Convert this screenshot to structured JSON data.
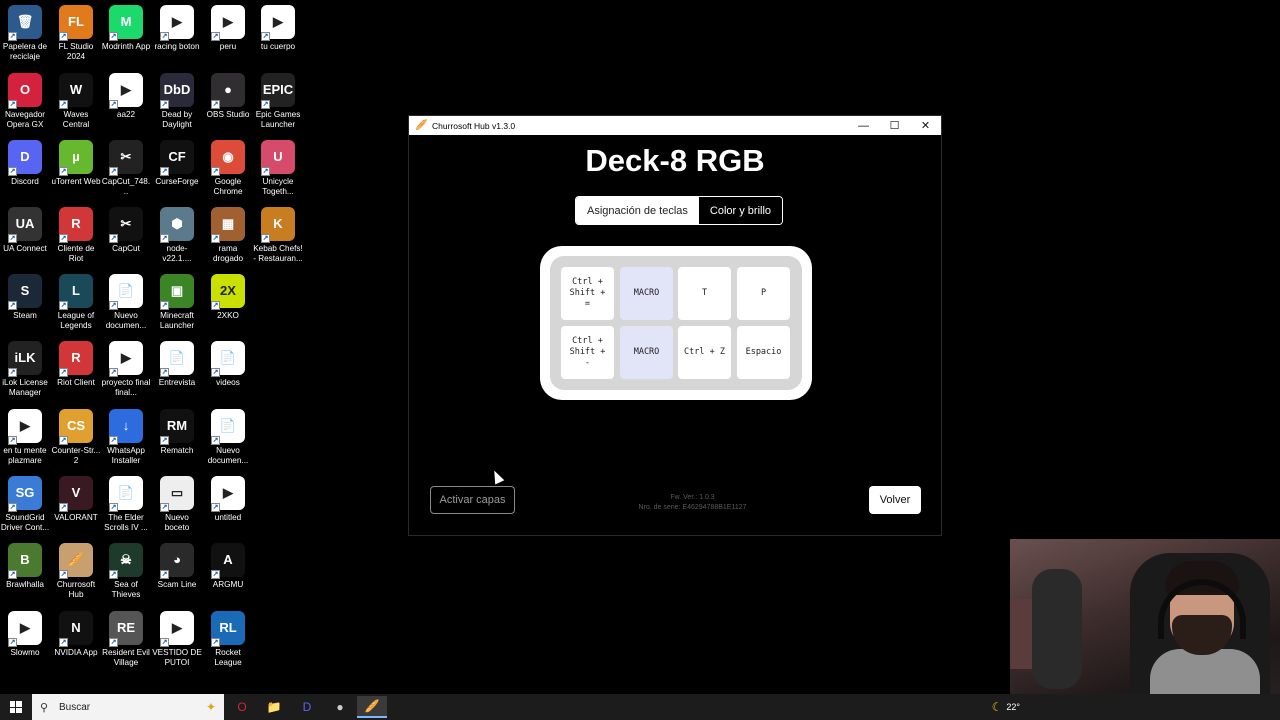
{
  "desktop": {
    "icons": [
      {
        "label": "Papelera de reciclaje",
        "glyph": "🗑",
        "color": "#2d5a8c"
      },
      {
        "label": "FL Studio 2024",
        "glyph": "FL",
        "color": "#e07a1a"
      },
      {
        "label": "Modrinth App",
        "glyph": "M",
        "color": "#1bd96a"
      },
      {
        "label": "racing boton",
        "glyph": "▶",
        "color": "#ffffff"
      },
      {
        "label": "peru",
        "glyph": "▶",
        "color": "#ffffff"
      },
      {
        "label": "tu cuerpo",
        "glyph": "▶",
        "color": "#ffffff"
      },
      {
        "label": "Navegador Opera GX",
        "glyph": "O",
        "color": "#d4213d"
      },
      {
        "label": "Waves Central",
        "glyph": "W",
        "color": "#111111"
      },
      {
        "label": "aa22",
        "glyph": "▶",
        "color": "#ffffff"
      },
      {
        "label": "Dead by Daylight",
        "glyph": "DbD",
        "color": "#2a2a3a"
      },
      {
        "label": "OBS Studio",
        "glyph": "●",
        "color": "#302e31"
      },
      {
        "label": "Epic Games Launcher",
        "glyph": "EPIC",
        "color": "#222222"
      },
      {
        "label": "Discord",
        "glyph": "D",
        "color": "#5865f2"
      },
      {
        "label": "uTorrent Web",
        "glyph": "µ",
        "color": "#66b82e"
      },
      {
        "label": "CapCut_748...",
        "glyph": "✂",
        "color": "#222222"
      },
      {
        "label": "CurseForge",
        "glyph": "CF",
        "color": "#111111"
      },
      {
        "label": "Google Chrome",
        "glyph": "◉",
        "color": "#dd4b39"
      },
      {
        "label": "Unicycle Togeth...",
        "glyph": "U",
        "color": "#d64a6a"
      },
      {
        "label": "UA Connect",
        "glyph": "UA",
        "color": "#333333"
      },
      {
        "label": "Cliente de Riot",
        "glyph": "R",
        "color": "#d13639"
      },
      {
        "label": "CapCut",
        "glyph": "✂",
        "color": "#111111"
      },
      {
        "label": "node-v22.1....",
        "glyph": "⬢",
        "color": "#5b7a8c"
      },
      {
        "label": "rama drogado",
        "glyph": "▦",
        "color": "#a06030"
      },
      {
        "label": "Kebab Chefs! - Restauran...",
        "glyph": "K",
        "color": "#c87d20"
      },
      {
        "label": "Steam",
        "glyph": "S",
        "color": "#1b2838"
      },
      {
        "label": "League of Legends",
        "glyph": "L",
        "color": "#1a4a5a"
      },
      {
        "label": "Nuevo documen...",
        "glyph": "📄",
        "color": "#ffffff"
      },
      {
        "label": "Minecraft Launcher",
        "glyph": "▣",
        "color": "#3c8527"
      },
      {
        "label": "2XKO",
        "glyph": "2X",
        "color": "#c9e000"
      },
      {
        "label": "iLok License Manager",
        "glyph": "iLK",
        "color": "#222222"
      },
      {
        "label": "Riot Client",
        "glyph": "R",
        "color": "#d13639"
      },
      {
        "label": "proyecto final final...",
        "glyph": "▶",
        "color": "#ffffff"
      },
      {
        "label": "Entrevista",
        "glyph": "📄",
        "color": "#ffffff"
      },
      {
        "label": "videos",
        "glyph": "📄",
        "color": "#ffffff"
      },
      {
        "label": "en tu mente plazmare",
        "glyph": "▶",
        "color": "#ffffff"
      },
      {
        "label": "Counter-Str... 2",
        "glyph": "CS",
        "color": "#e0a030"
      },
      {
        "label": "WhatsApp Installer",
        "glyph": "↓",
        "color": "#2d6cdf"
      },
      {
        "label": "Rematch",
        "glyph": "RM",
        "color": "#111111"
      },
      {
        "label": "Nuevo documen...",
        "glyph": "📄",
        "color": "#ffffff"
      },
      {
        "label": "SoundGrid Driver Cont...",
        "glyph": "SG",
        "color": "#3a7bd5"
      },
      {
        "label": "VALORANT",
        "glyph": "V",
        "color": "#3a1a22"
      },
      {
        "label": "The Elder Scrolls IV ...",
        "glyph": "📄",
        "color": "#ffffff"
      },
      {
        "label": "Nuevo boceto",
        "glyph": "▭",
        "color": "#eeeeee"
      },
      {
        "label": "untitled",
        "glyph": "▶",
        "color": "#ffffff"
      },
      {
        "label": "Brawlhalla",
        "glyph": "B",
        "color": "#4a7a30"
      },
      {
        "label": "Churrosoft Hub",
        "glyph": "🥖",
        "color": "#c8a070"
      },
      {
        "label": "Sea of Thieves",
        "glyph": "☠",
        "color": "#1e3a2a"
      },
      {
        "label": "Scam Line",
        "glyph": "◕",
        "color": "#2a2a2a"
      },
      {
        "label": "ARGMU",
        "glyph": "A",
        "color": "#111111"
      },
      {
        "label": "Slowmo",
        "glyph": "▶",
        "color": "#ffffff"
      },
      {
        "label": "NVIDIA App",
        "glyph": "N",
        "color": "#111111"
      },
      {
        "label": "Resident Evil Village",
        "glyph": "RE",
        "color": "#555555"
      },
      {
        "label": "VESTIDO DE PUTOI",
        "glyph": "▶",
        "color": "#ffffff"
      },
      {
        "label": "Rocket League",
        "glyph": "RL",
        "color": "#1b6ab8"
      }
    ]
  },
  "window": {
    "title": "Churrosoft Hub v1.3.0",
    "controls": {
      "minimize": "—",
      "maximize": "☐",
      "close": "✕"
    },
    "device_title": "Deck-8 RGB",
    "tabs": [
      {
        "label": "Asignación de teclas",
        "active": true
      },
      {
        "label": "Color y brillo",
        "active": false
      }
    ],
    "keys": [
      {
        "label": "Ctrl +\nShift +\n=",
        "macro": false
      },
      {
        "label": "MACRO",
        "macro": true
      },
      {
        "label": "T",
        "macro": false
      },
      {
        "label": "P",
        "macro": false
      },
      {
        "label": "Ctrl +\nShift +\n-",
        "macro": false
      },
      {
        "label": "MACRO",
        "macro": true
      },
      {
        "label": "Ctrl + Z",
        "macro": false
      },
      {
        "label": "Espacio",
        "macro": false
      }
    ],
    "activate_layers_label": "Activar capas",
    "fw_version": "Fw. Ver.: 1.0.3",
    "serial": "Nro. de serie: E46294788B1E1127",
    "back_label": "Volver"
  },
  "taskbar": {
    "search_placeholder": "Buscar",
    "apps": [
      {
        "name": "opera-gx-icon",
        "glyph": "O",
        "color": "#d4213d"
      },
      {
        "name": "file-explorer-icon",
        "glyph": "📁",
        "color": "#f0c040"
      },
      {
        "name": "discord-icon",
        "glyph": "D",
        "color": "#5865f2"
      },
      {
        "name": "obs-icon",
        "glyph": "●",
        "color": "#cccccc"
      },
      {
        "name": "churrosoft-hub-icon",
        "glyph": "🥖",
        "color": "#c8a070"
      }
    ],
    "temperature": "22°"
  }
}
